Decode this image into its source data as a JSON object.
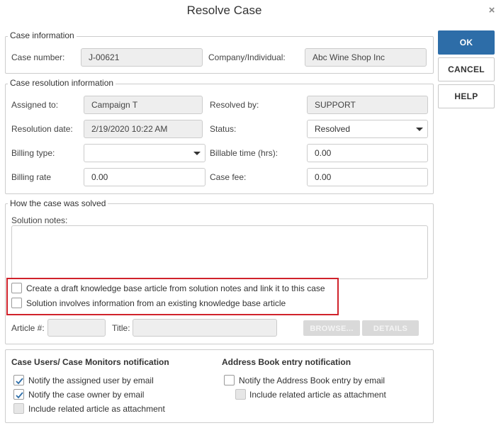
{
  "dialog": {
    "title": "Resolve Case",
    "close_icon": "×"
  },
  "buttons": {
    "ok": "OK",
    "cancel": "CANCEL",
    "help": "HELP"
  },
  "case_info": {
    "legend": "Case information",
    "case_number_label": "Case number:",
    "case_number_value": "J-00621",
    "company_label": "Company/Individual:",
    "company_value": "Abc Wine Shop Inc"
  },
  "resolution": {
    "legend": "Case resolution information",
    "assigned_to_label": "Assigned to:",
    "assigned_to_value": "Campaign T",
    "resolved_by_label": "Resolved by:",
    "resolved_by_value": "SUPPORT",
    "resolution_date_label": "Resolution date:",
    "resolution_date_value": "2/19/2020 10:22 AM",
    "status_label": "Status:",
    "status_value": "Resolved",
    "billing_type_label": "Billing type:",
    "billing_type_value": "",
    "billable_time_label": "Billable time (hrs):",
    "billable_time_value": "0.00",
    "billing_rate_label": "Billing rate",
    "billing_rate_value": "0.00",
    "case_fee_label": "Case fee:",
    "case_fee_value": "0.00"
  },
  "solved": {
    "legend": "How the case was solved",
    "solution_notes_label": "Solution notes:",
    "solution_notes_value": "",
    "create_draft_label": "Create a draft knowledge base article from solution notes and link it to this case",
    "create_draft_checked": false,
    "existing_article_label": "Solution involves information from an existing knowledge base article",
    "existing_article_checked": false,
    "article_num_label": "Article #:",
    "article_num_value": "",
    "title_label": "Title:",
    "title_value": "",
    "browse_label": "BROWSE...",
    "details_label": "DETAILS"
  },
  "notifications": {
    "case_users_heading": "Case Users/ Case Monitors notification",
    "notify_assigned_label": "Notify the assigned user by email",
    "notify_assigned_checked": true,
    "notify_owner_label": "Notify the case owner by email",
    "notify_owner_checked": true,
    "include_related_label": "Include related article as attachment",
    "include_related_checked": false,
    "address_book_heading": "Address Book entry notification",
    "notify_address_label": "Notify the Address Book entry by email",
    "notify_address_checked": false,
    "include_related_ab_label": "Include related article as attachment",
    "include_related_ab_checked": false
  },
  "colors": {
    "primary_button": "#2d6da8",
    "highlight_border": "#d0222b",
    "check_mark": "#2d6da8"
  }
}
